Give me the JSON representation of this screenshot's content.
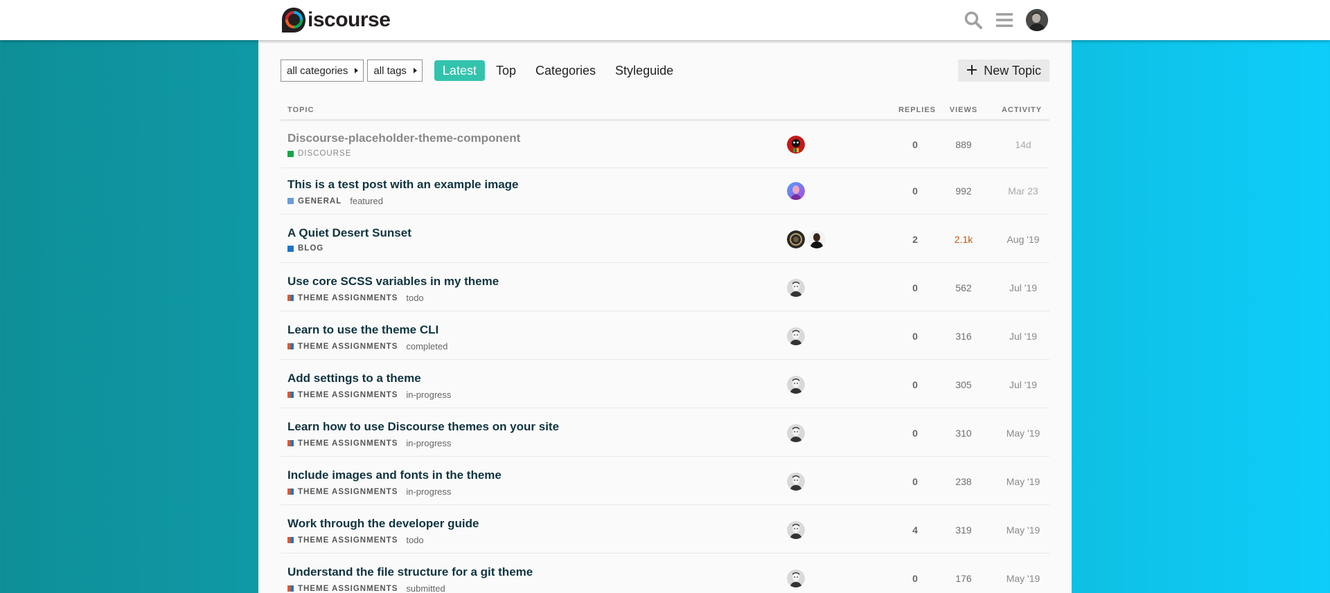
{
  "header": {
    "logo_text": "iscourse",
    "logo_letter": "D",
    "icons": [
      "search-icon",
      "hamburger-menu-icon",
      "user-avatar"
    ]
  },
  "nav": {
    "categories_dropdown": "all categories",
    "tags_dropdown": "all tags",
    "tabs": [
      "Latest",
      "Top",
      "Categories",
      "Styleguide"
    ],
    "active_tab": "Latest",
    "new_topic": "New Topic"
  },
  "columns": {
    "topic": "TOPIC",
    "replies": "REPLIES",
    "views": "VIEWS",
    "activity": "ACTIVITY"
  },
  "colors": {
    "accent": "#33c3ad",
    "title": "#0f3440",
    "hot_views": "#c95610"
  },
  "topics": [
    {
      "title": "Discourse-placeholder-theme-component",
      "category": "DISCOURSE",
      "category_color": "#1aa54a",
      "tag": "",
      "replies": "0",
      "views": "889",
      "activity": "14d",
      "visited": true,
      "posters": [
        "red-poster-avatar"
      ]
    },
    {
      "title": "This is a test post with an example image",
      "category": "GENERAL",
      "category_color": "#6b9dd6",
      "tag": "featured",
      "replies": "0",
      "views": "992",
      "activity": "Mar 23",
      "visited": false,
      "posters": [
        "purple-poster-avatar"
      ]
    },
    {
      "title": "A Quiet Desert Sunset",
      "category": "BLOG",
      "category_color": "#1f75c4",
      "tag": "",
      "replies": "2",
      "views": "2.1k",
      "activity": "Aug '19",
      "visited": false,
      "posters": [
        "dark-poster-avatar",
        "black-poster-avatar"
      ]
    },
    {
      "title": "Use core SCSS variables in my theme",
      "category": "THEME ASSIGNMENTS",
      "category_color": "#e05a2a",
      "tag": "todo",
      "replies": "0",
      "views": "562",
      "activity": "Jul '19",
      "visited": false,
      "posters": [
        "grey-poster-avatar"
      ]
    },
    {
      "title": "Learn to use the theme CLI",
      "category": "THEME ASSIGNMENTS",
      "category_color": "#e05a2a",
      "tag": "completed",
      "replies": "0",
      "views": "316",
      "activity": "Jul '19",
      "visited": false,
      "posters": [
        "grey-poster-avatar"
      ]
    },
    {
      "title": "Add settings to a theme",
      "category": "THEME ASSIGNMENTS",
      "category_color": "#e05a2a",
      "tag": "in-progress",
      "replies": "0",
      "views": "305",
      "activity": "Jul '19",
      "visited": false,
      "posters": [
        "grey-poster-avatar"
      ]
    },
    {
      "title": "Learn how to use Discourse themes on your site",
      "category": "THEME ASSIGNMENTS",
      "category_color": "#e05a2a",
      "tag": "in-progress",
      "replies": "0",
      "views": "310",
      "activity": "May '19",
      "visited": false,
      "posters": [
        "grey-poster-avatar"
      ]
    },
    {
      "title": "Include images and fonts in the theme",
      "category": "THEME ASSIGNMENTS",
      "category_color": "#e05a2a",
      "tag": "in-progress",
      "replies": "0",
      "views": "238",
      "activity": "May '19",
      "visited": false,
      "posters": [
        "grey-poster-avatar"
      ]
    },
    {
      "title": "Work through the developer guide",
      "category": "THEME ASSIGNMENTS",
      "category_color": "#e05a2a",
      "tag": "todo",
      "replies": "4",
      "views": "319",
      "activity": "May '19",
      "visited": false,
      "posters": [
        "grey-poster-avatar"
      ]
    },
    {
      "title": "Understand the file structure for a git theme",
      "category": "THEME ASSIGNMENTS",
      "category_color": "#e05a2a",
      "tag": "submitted",
      "replies": "0",
      "views": "176",
      "activity": "May '19",
      "visited": false,
      "posters": [
        "grey-poster-avatar"
      ]
    }
  ]
}
